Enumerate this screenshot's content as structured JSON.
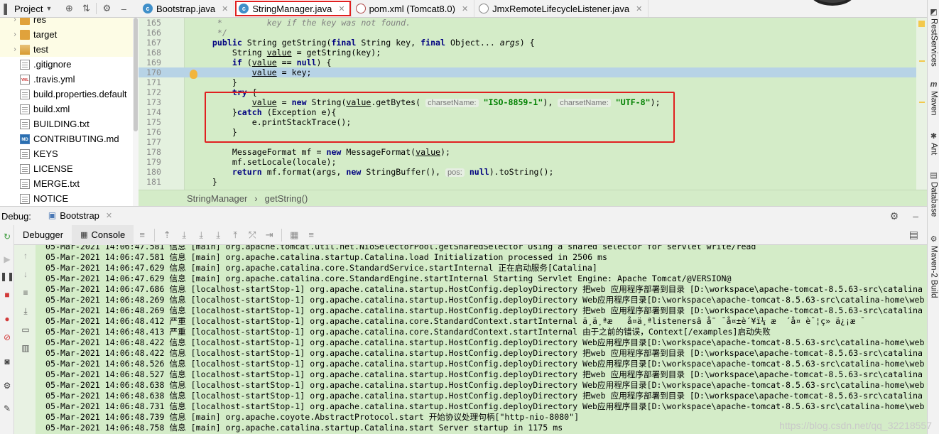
{
  "project_panel": {
    "title": "Project",
    "items": [
      {
        "label": "res",
        "type": "folder"
      },
      {
        "label": "target",
        "type": "folder"
      },
      {
        "label": "test",
        "type": "folder-test"
      },
      {
        "label": ".gitignore",
        "type": "file"
      },
      {
        "label": ".travis.yml",
        "type": "yml"
      },
      {
        "label": "build.properties.default",
        "type": "file"
      },
      {
        "label": "build.xml",
        "type": "file"
      },
      {
        "label": "BUILDING.txt",
        "type": "file"
      },
      {
        "label": "CONTRIBUTING.md",
        "type": "md"
      },
      {
        "label": "KEYS",
        "type": "file"
      },
      {
        "label": "LICENSE",
        "type": "file"
      },
      {
        "label": "MERGE.txt",
        "type": "file"
      },
      {
        "label": "NOTICE",
        "type": "file"
      }
    ]
  },
  "tabs": [
    {
      "label": "Bootstrap.java",
      "icon": "class-icon"
    },
    {
      "label": "StringManager.java",
      "icon": "class-icon",
      "active": true
    },
    {
      "label": "pom.xml (Tomcat8.0)",
      "icon": "maven-icon"
    },
    {
      "label": "JmxRemoteLifecycleListener.java",
      "icon": "java-file-icon"
    }
  ],
  "editor": {
    "lines": [
      {
        "num": "165",
        "html": "<span class=\"cmt\">     *         key if the key was not found.</span>"
      },
      {
        "num": "166",
        "html": "<span class=\"cmt\">     */</span>"
      },
      {
        "num": "167",
        "html": "    <span class=\"kw\">public</span> String getString(<span class=\"kw\">final</span> String key, <span class=\"kw\">final</span> Object... <i>args</i>) {"
      },
      {
        "num": "168",
        "html": "        String <u>value</u> = getString(key);"
      },
      {
        "num": "169",
        "html": "        <span class=\"kw\">if</span> (<u>value</u> == <span class=\"kw\">null</span>) {"
      },
      {
        "num": "170",
        "html": "            <u>value</u> = key;",
        "current": true
      },
      {
        "num": "171",
        "html": "        }"
      },
      {
        "num": "172",
        "html": "        <span class=\"kw\">try</span> {"
      },
      {
        "num": "173",
        "html": "            <u>value</u> = <span class=\"kw\">new</span> String(<u>value</u>.getBytes( <span class=\"hint\">charsetName:</span> <span class=\"str\">\"ISO-8859-1\"</span>), <span class=\"hint\">charsetName:</span> <span class=\"str\">\"UTF-8\"</span>);"
      },
      {
        "num": "174",
        "html": "        }<span class=\"kw\">catch</span> (Exception e){"
      },
      {
        "num": "175",
        "html": "            e.printStackTrace();"
      },
      {
        "num": "176",
        "html": "        }"
      },
      {
        "num": "177",
        "html": ""
      },
      {
        "num": "178",
        "html": "        MessageFormat mf = <span class=\"kw\">new</span> MessageFormat(<u>value</u>);"
      },
      {
        "num": "179",
        "html": "        mf.setLocale(locale);"
      },
      {
        "num": "180",
        "html": "        <span class=\"kw\">return</span> mf.format(args, <span class=\"kw\">new</span> StringBuffer(), <span class=\"hint\">pos:</span> <span class=\"kw\">null</span>).toString();"
      },
      {
        "num": "181",
        "html": "    }"
      }
    ],
    "breadcrumb": [
      "StringManager",
      "getString()"
    ]
  },
  "right_sidebar": [
    "RestServices",
    "Maven",
    "Ant",
    "Database",
    "Maven-2 Build"
  ],
  "debug": {
    "label": "Debug:",
    "session": "Bootstrap",
    "tabs": [
      "Debugger",
      "Console"
    ]
  },
  "console_lines": [
    "05-Mar-2021 14:06:47.581 信息 [main] org.apache.tomcat.util.net.NioSelectorPool.getSharedSelector Using a shared selector for servlet write/read",
    "05-Mar-2021 14:06:47.581 信息 [main] org.apache.catalina.startup.Catalina.load Initialization processed in 2506 ms",
    "05-Mar-2021 14:06:47.629 信息 [main] org.apache.catalina.core.StandardService.startInternal 正在启动服务[Catalina]",
    "05-Mar-2021 14:06:47.629 信息 [main] org.apache.catalina.core.StandardEngine.startInternal Starting Servlet Engine: Apache Tomcat/@VERSION@",
    "05-Mar-2021 14:06:47.686 信息 [localhost-startStop-1] org.apache.catalina.startup.HostConfig.deployDirectory 把web 应用程序部署到目录 [D:\\workspace\\apache-tomcat-8.5.63-src\\catalina",
    "05-Mar-2021 14:06:48.269 信息 [localhost-startStop-1] org.apache.catalina.startup.HostConfig.deployDirectory Web应用程序目录[D:\\workspace\\apache-tomcat-8.5.63-src\\catalina-home\\web",
    "05-Mar-2021 14:06:48.269 信息 [localhost-startStop-1] org.apache.catalina.startup.HostConfig.deployDirectory 把web 应用程序部署到目录 [D:\\workspace\\apache-tomcat-8.5.63-src\\catalina",
    "05-Mar-2021 14:06:48.412 严重 [localhost-startStop-1] org.apache.catalina.core.StandardContext.startInternal ä¸ä¸ªæ   å¤ä¸ªlistenersâ å¨ ¯å¤±è´¥ï¼ æ  ´å¤ è¯¦ç» ä¿¡æ ¯",
    "05-Mar-2021 14:06:48.413 严重 [localhost-startStop-1] org.apache.catalina.core.StandardContext.startInternal 由于之前的错误，Context[/examples]启动失败",
    "05-Mar-2021 14:06:48.422 信息 [localhost-startStop-1] org.apache.catalina.startup.HostConfig.deployDirectory Web应用程序目录[D:\\workspace\\apache-tomcat-8.5.63-src\\catalina-home\\web",
    "05-Mar-2021 14:06:48.422 信息 [localhost-startStop-1] org.apache.catalina.startup.HostConfig.deployDirectory 把web 应用程序部署到目录 [D:\\workspace\\apache-tomcat-8.5.63-src\\catalina",
    "05-Mar-2021 14:06:48.526 信息 [localhost-startStop-1] org.apache.catalina.startup.HostConfig.deployDirectory Web应用程序目录[D:\\workspace\\apache-tomcat-8.5.63-src\\catalina-home\\web",
    "05-Mar-2021 14:06:48.527 信息 [localhost-startStop-1] org.apache.catalina.startup.HostConfig.deployDirectory 把web 应用程序部署到目录 [D:\\workspace\\apache-tomcat-8.5.63-src\\catalina",
    "05-Mar-2021 14:06:48.638 信息 [localhost-startStop-1] org.apache.catalina.startup.HostConfig.deployDirectory Web应用程序目录[D:\\workspace\\apache-tomcat-8.5.63-src\\catalina-home\\web",
    "05-Mar-2021 14:06:48.638 信息 [localhost-startStop-1] org.apache.catalina.startup.HostConfig.deployDirectory 把web 应用程序部署到目录 [D:\\workspace\\apache-tomcat-8.5.63-src\\catalina",
    "05-Mar-2021 14:06:48.731 信息 [localhost-startStop-1] org.apache.catalina.startup.HostConfig.deployDirectory Web应用程序目录[D:\\workspace\\apache-tomcat-8.5.63-src\\catalina-home\\web",
    "05-Mar-2021 14:06:48.739 信息 [main] org.apache.coyote.AbstractProtocol.start 开始协议处理句柄[\"http-nio-8080\"]",
    "05-Mar-2021 14:06:48.758 信息 [main] org.apache.catalina.startup.Catalina.start Server startup in 1175 ms"
  ],
  "watermark": "https://blog.csdn.net/qq_32218557"
}
